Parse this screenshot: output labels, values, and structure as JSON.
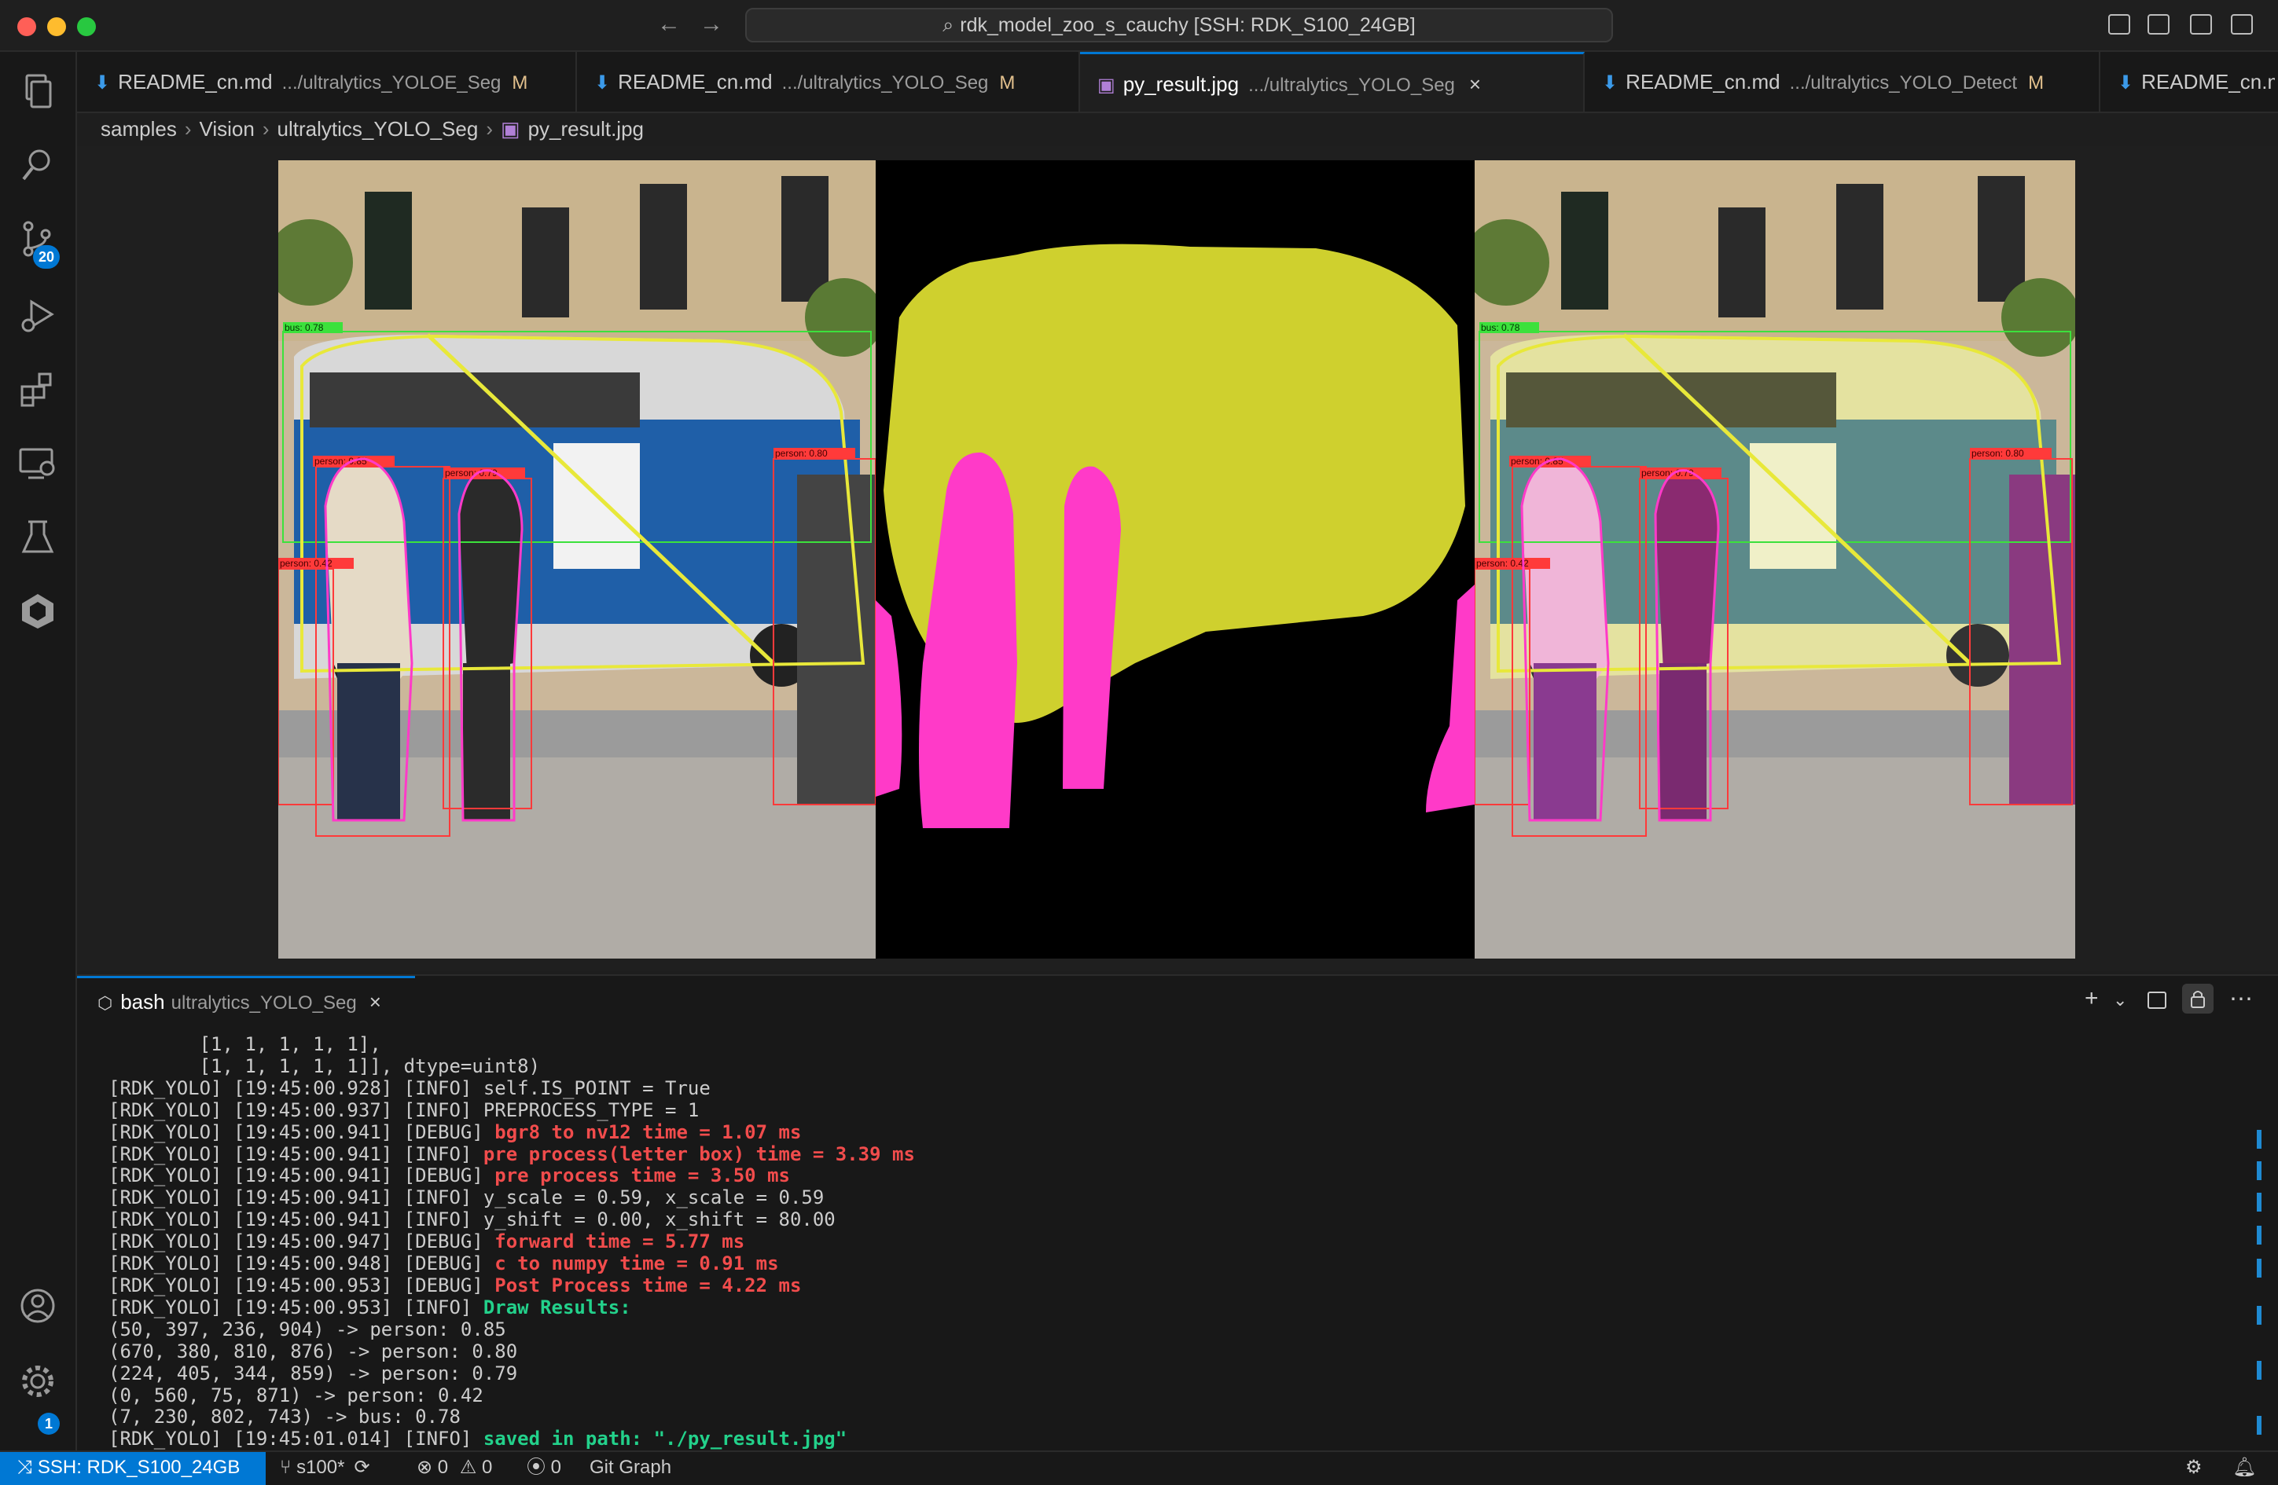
{
  "window": {
    "title": "rdk_model_zoo_s_cauchy [SSH: RDK_S100_24GB]",
    "traffic_colors": {
      "close": "#ff5f57",
      "minimize": "#febc2e",
      "maximize": "#28c840"
    }
  },
  "accent_color": "#0078d4",
  "activity_bar": {
    "items": [
      {
        "icon": "explorer-icon"
      },
      {
        "icon": "search-icon"
      },
      {
        "icon": "source-control-icon",
        "badge": "20"
      },
      {
        "icon": "run-debug-icon"
      },
      {
        "icon": "extensions-icon"
      },
      {
        "icon": "remote-explorer-icon"
      },
      {
        "icon": "testing-icon"
      },
      {
        "icon": "cnb-icon"
      }
    ],
    "bottom": [
      {
        "icon": "accounts-icon"
      },
      {
        "icon": "manage-gear-icon",
        "badge": "1"
      }
    ]
  },
  "tabs": [
    {
      "name": "README_cn.md",
      "path": ".../ultralytics_YOLOE_Seg",
      "status": "M",
      "icon": "markdown-icon",
      "active": false
    },
    {
      "name": "README_cn.md",
      "path": ".../ultralytics_YOLO_Seg",
      "status": "M",
      "icon": "markdown-icon",
      "active": false
    },
    {
      "name": "py_result.jpg",
      "path": ".../ultralytics_YOLO_Seg",
      "status": "×",
      "icon": "image-file-icon",
      "active": true
    },
    {
      "name": "README_cn.md",
      "path": ".../ultralytics_YOLO_Detect",
      "status": "M",
      "icon": "markdown-icon",
      "active": false
    },
    {
      "name": "README_cn.m",
      "path": "",
      "status": "",
      "icon": "markdown-icon",
      "active": false
    }
  ],
  "tabs_more": "⋯",
  "breadcrumb": [
    "samples",
    "Vision",
    "ultralytics_YOLO_Seg",
    "py_result.jpg"
  ],
  "image_labels": {
    "bus": "bus: 0.78",
    "p1": "person: 0.85",
    "p2": "person: 0.80",
    "p3": "person: 0.79",
    "p4": "person: 0.42",
    "mask_bus_color": "#cfd02e",
    "mask_person_color": "#ff3ac8"
  },
  "panel": {
    "tab_name": "bash",
    "tab_dir": "ultralytics_YOLO_Seg",
    "actions": [
      "+",
      "⌄",
      "split-icon",
      "lock-icon",
      "⋯"
    ]
  },
  "terminal": {
    "lines": [
      {
        "pre": "        [1, 1, 1, 1, 1],",
        "msg": "",
        "cls": ""
      },
      {
        "pre": "        [1, 1, 1, 1, 1]], dtype=uint8)",
        "msg": "",
        "cls": ""
      },
      {
        "pre": "[RDK_YOLO] [19:45:00.928] [INFO] ",
        "msg": "self.IS_POINT = True",
        "cls": ""
      },
      {
        "pre": "[RDK_YOLO] [19:45:00.937] [INFO] ",
        "msg": "PREPROCESS_TYPE = 1",
        "cls": ""
      },
      {
        "pre": "[RDK_YOLO] [19:45:00.941] [DEBUG] ",
        "msg": "bgr8 to nv12 time = 1.07 ms",
        "cls": "red"
      },
      {
        "pre": "[RDK_YOLO] [19:45:00.941] [INFO] ",
        "msg": "pre process(letter box) time = 3.39 ms",
        "cls": "red"
      },
      {
        "pre": "[RDK_YOLO] [19:45:00.941] [DEBUG] ",
        "msg": "pre process time = 3.50 ms",
        "cls": "red"
      },
      {
        "pre": "[RDK_YOLO] [19:45:00.941] [INFO] ",
        "msg": "y_scale = 0.59, x_scale = 0.59",
        "cls": ""
      },
      {
        "pre": "[RDK_YOLO] [19:45:00.941] [INFO] ",
        "msg": "y_shift = 0.00, x_shift = 80.00",
        "cls": ""
      },
      {
        "pre": "[RDK_YOLO] [19:45:00.947] [DEBUG] ",
        "msg": "forward time = 5.77 ms",
        "cls": "red"
      },
      {
        "pre": "[RDK_YOLO] [19:45:00.948] [DEBUG] ",
        "msg": "c to numpy time = 0.91 ms",
        "cls": "red"
      },
      {
        "pre": "[RDK_YOLO] [19:45:00.953] [DEBUG] ",
        "msg": "Post Process time = 4.22 ms",
        "cls": "red"
      },
      {
        "pre": "[RDK_YOLO] [19:45:00.953] [INFO] ",
        "msg": "Draw Results:",
        "cls": "green"
      },
      {
        "pre": "(50, 397, 236, 904) -> person: 0.85",
        "msg": "",
        "cls": ""
      },
      {
        "pre": "(670, 380, 810, 876) -> person: 0.80",
        "msg": "",
        "cls": ""
      },
      {
        "pre": "(224, 405, 344, 859) -> person: 0.79",
        "msg": "",
        "cls": ""
      },
      {
        "pre": "(0, 560, 75, 871) -> person: 0.42",
        "msg": "",
        "cls": ""
      },
      {
        "pre": "(7, 230, 802, 743) -> bus: 0.78",
        "msg": "",
        "cls": ""
      },
      {
        "pre": "[RDK_YOLO] [19:45:01.014] [INFO] ",
        "msg": "saved in path: \"./py_result.jpg\"",
        "cls": "green"
      }
    ]
  },
  "statusbar": {
    "remote": "SSH: RDK_S100_24GB",
    "branch": "s100*",
    "errors": "0",
    "warnings": "0",
    "ports": "0",
    "git_graph": "Git Graph"
  }
}
